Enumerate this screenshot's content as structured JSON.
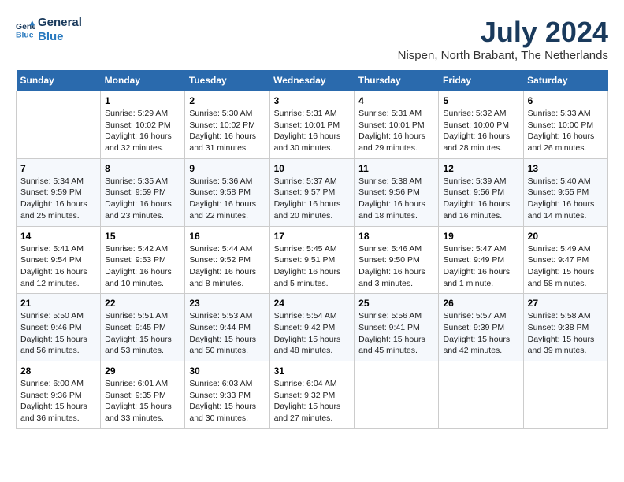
{
  "logo": {
    "line1": "General",
    "line2": "Blue"
  },
  "title": "July 2024",
  "subtitle": "Nispen, North Brabant, The Netherlands",
  "headers": [
    "Sunday",
    "Monday",
    "Tuesday",
    "Wednesday",
    "Thursday",
    "Friday",
    "Saturday"
  ],
  "weeks": [
    [
      {
        "day": "",
        "info": ""
      },
      {
        "day": "1",
        "info": "Sunrise: 5:29 AM\nSunset: 10:02 PM\nDaylight: 16 hours\nand 32 minutes."
      },
      {
        "day": "2",
        "info": "Sunrise: 5:30 AM\nSunset: 10:02 PM\nDaylight: 16 hours\nand 31 minutes."
      },
      {
        "day": "3",
        "info": "Sunrise: 5:31 AM\nSunset: 10:01 PM\nDaylight: 16 hours\nand 30 minutes."
      },
      {
        "day": "4",
        "info": "Sunrise: 5:31 AM\nSunset: 10:01 PM\nDaylight: 16 hours\nand 29 minutes."
      },
      {
        "day": "5",
        "info": "Sunrise: 5:32 AM\nSunset: 10:00 PM\nDaylight: 16 hours\nand 28 minutes."
      },
      {
        "day": "6",
        "info": "Sunrise: 5:33 AM\nSunset: 10:00 PM\nDaylight: 16 hours\nand 26 minutes."
      }
    ],
    [
      {
        "day": "7",
        "info": "Sunrise: 5:34 AM\nSunset: 9:59 PM\nDaylight: 16 hours\nand 25 minutes."
      },
      {
        "day": "8",
        "info": "Sunrise: 5:35 AM\nSunset: 9:59 PM\nDaylight: 16 hours\nand 23 minutes."
      },
      {
        "day": "9",
        "info": "Sunrise: 5:36 AM\nSunset: 9:58 PM\nDaylight: 16 hours\nand 22 minutes."
      },
      {
        "day": "10",
        "info": "Sunrise: 5:37 AM\nSunset: 9:57 PM\nDaylight: 16 hours\nand 20 minutes."
      },
      {
        "day": "11",
        "info": "Sunrise: 5:38 AM\nSunset: 9:56 PM\nDaylight: 16 hours\nand 18 minutes."
      },
      {
        "day": "12",
        "info": "Sunrise: 5:39 AM\nSunset: 9:56 PM\nDaylight: 16 hours\nand 16 minutes."
      },
      {
        "day": "13",
        "info": "Sunrise: 5:40 AM\nSunset: 9:55 PM\nDaylight: 16 hours\nand 14 minutes."
      }
    ],
    [
      {
        "day": "14",
        "info": "Sunrise: 5:41 AM\nSunset: 9:54 PM\nDaylight: 16 hours\nand 12 minutes."
      },
      {
        "day": "15",
        "info": "Sunrise: 5:42 AM\nSunset: 9:53 PM\nDaylight: 16 hours\nand 10 minutes."
      },
      {
        "day": "16",
        "info": "Sunrise: 5:44 AM\nSunset: 9:52 PM\nDaylight: 16 hours\nand 8 minutes."
      },
      {
        "day": "17",
        "info": "Sunrise: 5:45 AM\nSunset: 9:51 PM\nDaylight: 16 hours\nand 5 minutes."
      },
      {
        "day": "18",
        "info": "Sunrise: 5:46 AM\nSunset: 9:50 PM\nDaylight: 16 hours\nand 3 minutes."
      },
      {
        "day": "19",
        "info": "Sunrise: 5:47 AM\nSunset: 9:49 PM\nDaylight: 16 hours\nand 1 minute."
      },
      {
        "day": "20",
        "info": "Sunrise: 5:49 AM\nSunset: 9:47 PM\nDaylight: 15 hours\nand 58 minutes."
      }
    ],
    [
      {
        "day": "21",
        "info": "Sunrise: 5:50 AM\nSunset: 9:46 PM\nDaylight: 15 hours\nand 56 minutes."
      },
      {
        "day": "22",
        "info": "Sunrise: 5:51 AM\nSunset: 9:45 PM\nDaylight: 15 hours\nand 53 minutes."
      },
      {
        "day": "23",
        "info": "Sunrise: 5:53 AM\nSunset: 9:44 PM\nDaylight: 15 hours\nand 50 minutes."
      },
      {
        "day": "24",
        "info": "Sunrise: 5:54 AM\nSunset: 9:42 PM\nDaylight: 15 hours\nand 48 minutes."
      },
      {
        "day": "25",
        "info": "Sunrise: 5:56 AM\nSunset: 9:41 PM\nDaylight: 15 hours\nand 45 minutes."
      },
      {
        "day": "26",
        "info": "Sunrise: 5:57 AM\nSunset: 9:39 PM\nDaylight: 15 hours\nand 42 minutes."
      },
      {
        "day": "27",
        "info": "Sunrise: 5:58 AM\nSunset: 9:38 PM\nDaylight: 15 hours\nand 39 minutes."
      }
    ],
    [
      {
        "day": "28",
        "info": "Sunrise: 6:00 AM\nSunset: 9:36 PM\nDaylight: 15 hours\nand 36 minutes."
      },
      {
        "day": "29",
        "info": "Sunrise: 6:01 AM\nSunset: 9:35 PM\nDaylight: 15 hours\nand 33 minutes."
      },
      {
        "day": "30",
        "info": "Sunrise: 6:03 AM\nSunset: 9:33 PM\nDaylight: 15 hours\nand 30 minutes."
      },
      {
        "day": "31",
        "info": "Sunrise: 6:04 AM\nSunset: 9:32 PM\nDaylight: 15 hours\nand 27 minutes."
      },
      {
        "day": "",
        "info": ""
      },
      {
        "day": "",
        "info": ""
      },
      {
        "day": "",
        "info": ""
      }
    ]
  ]
}
